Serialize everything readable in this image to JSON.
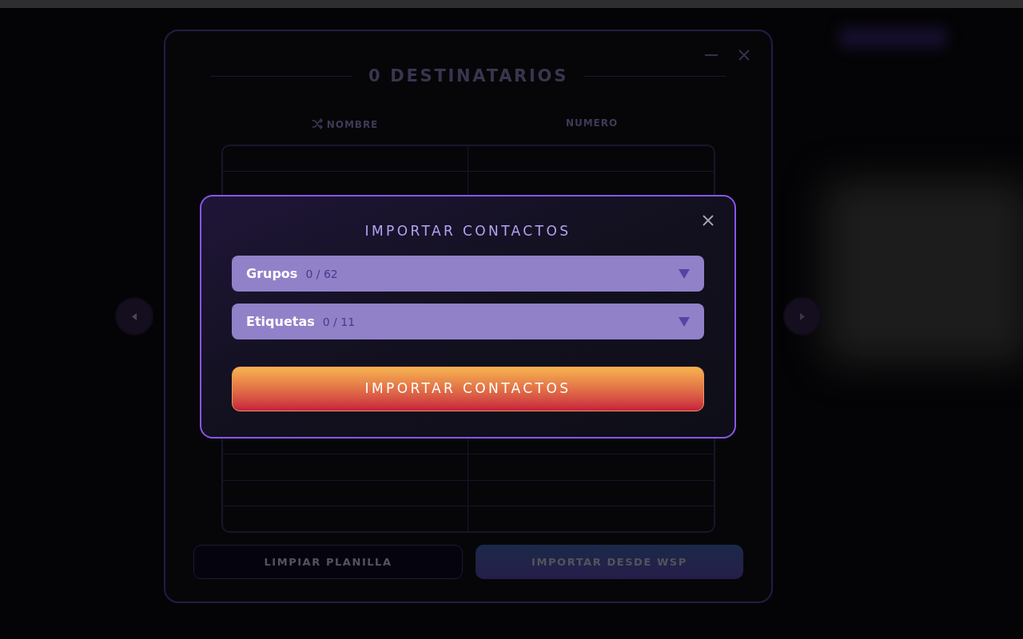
{
  "recipients_panel": {
    "title": "0 DESTINATARIOS",
    "columns": [
      {
        "label": "NOMBRE",
        "sortable": true
      },
      {
        "label": "NUMERO",
        "sortable": false
      }
    ],
    "buttons": [
      {
        "label": "LIMPIAR PLANILLA",
        "kind": "outline"
      },
      {
        "label": "IMPORTAR DESDE WSP",
        "kind": "filled"
      }
    ]
  },
  "import_dialog": {
    "title": "IMPORTAR CONTACTOS",
    "dropdowns": [
      {
        "label": "Grupos",
        "count": "0 / 62",
        "expanded": false
      },
      {
        "label": "Etiquetas",
        "count": "0 / 11",
        "expanded": false
      }
    ],
    "button": "IMPORTAR CONTACTOS"
  }
}
